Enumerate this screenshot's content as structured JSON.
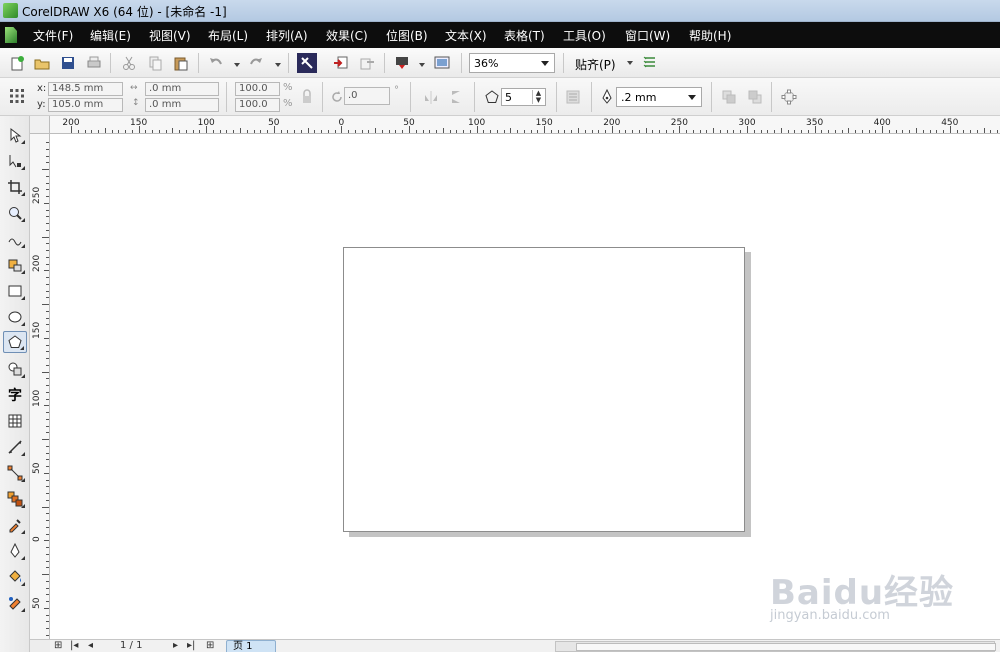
{
  "window": {
    "title": "CorelDRAW X6 (64 位) - [未命名 -1]"
  },
  "menu": {
    "items": [
      {
        "label": "文件(F)"
      },
      {
        "label": "编辑(E)"
      },
      {
        "label": "视图(V)"
      },
      {
        "label": "布局(L)"
      },
      {
        "label": "排列(A)"
      },
      {
        "label": "效果(C)"
      },
      {
        "label": "位图(B)"
      },
      {
        "label": "文本(X)"
      },
      {
        "label": "表格(T)"
      },
      {
        "label": "工具(O)"
      },
      {
        "label": "窗口(W)"
      },
      {
        "label": "帮助(H)"
      }
    ]
  },
  "toolbar": {
    "zoom": "36%",
    "snap_label": "贴齐(P)"
  },
  "propertybar": {
    "x_label": "x:",
    "x_value": "148.5 mm",
    "y_label": "y:",
    "y_value": "105.0 mm",
    "w_value": ".0 mm",
    "h_value": ".0 mm",
    "scale_w": "100.0",
    "scale_h": "100.0",
    "pct": "%",
    "angle": ".0",
    "degree": "°",
    "sides": "5",
    "outline": ".2 mm"
  },
  "ruler": {
    "h_labels": [
      "200",
      "150",
      "100",
      "50",
      "0",
      "50",
      "100",
      "150",
      "200",
      "250",
      "300",
      "350",
      "400",
      "450"
    ],
    "v_labels": [
      "250",
      "200",
      "150",
      "100",
      "50",
      "0",
      "50"
    ]
  },
  "pagenav": {
    "count": "1 / 1",
    "tab": "页 1"
  },
  "watermark": {
    "text": "Baidu经验",
    "sub": "jingyan.baidu.com"
  }
}
